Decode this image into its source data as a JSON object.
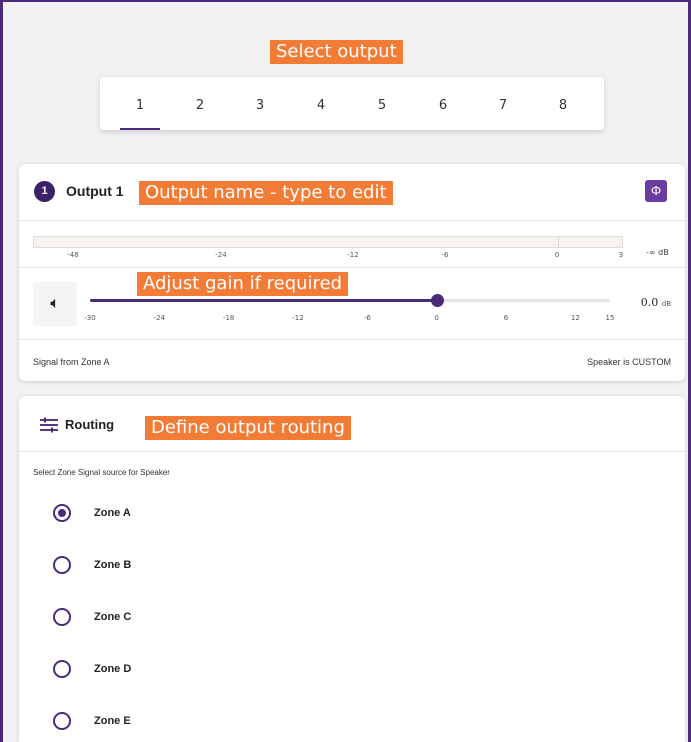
{
  "annotations": {
    "select_output": "Select output",
    "output_name": "Output name - type to edit",
    "adjust_gain": "Adjust gain if required",
    "define_routing": "Define output routing"
  },
  "output_tabs": {
    "items": [
      "1",
      "2",
      "3",
      "4",
      "5",
      "6",
      "7",
      "8"
    ],
    "selected": "1"
  },
  "output_card": {
    "badge": "1",
    "title": "Output 1",
    "phase_icon": "phase-invert-icon",
    "meter": {
      "scale": [
        "-48",
        "-24",
        "-12",
        "-6",
        "0",
        "3"
      ],
      "readout_value": "-∞",
      "readout_unit": "dB"
    },
    "gain": {
      "speaker_icon": "speaker-icon",
      "scale": [
        "-30",
        "-24",
        "-18",
        "-12",
        "-6",
        "0",
        "6",
        "12",
        "15"
      ],
      "value": 0.0,
      "min": -30,
      "max": 15,
      "value_text": "0.0",
      "unit": "dB"
    },
    "signal_from": "Signal from Zone A",
    "speaker_type": "Speaker is CUSTOM"
  },
  "routing_card": {
    "icon": "routing-icon",
    "title": "Routing",
    "description": "Select Zone Signal source for Speaker",
    "options": [
      "Zone A",
      "Zone B",
      "Zone C",
      "Zone D",
      "Zone E"
    ],
    "selected": "Zone A"
  },
  "colors": {
    "accent": "#4a2a7a",
    "annotation": "#f27b35",
    "phase_button": "#6a3ba0"
  }
}
